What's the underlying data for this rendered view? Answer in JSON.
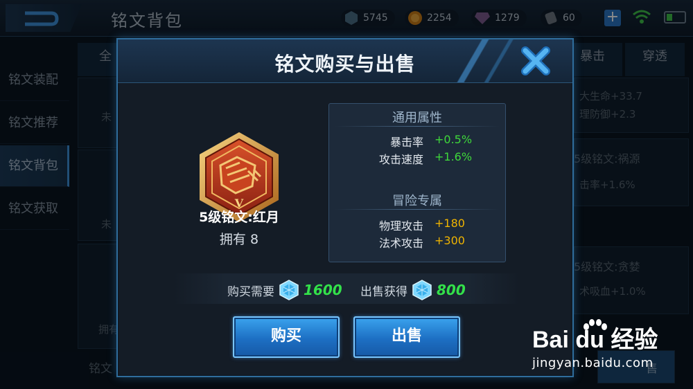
{
  "background": {
    "title": "铭文背包",
    "resources": [
      {
        "icon": "crystal-icon",
        "value": "5745"
      },
      {
        "icon": "gold-coin-icon",
        "value": "2254"
      },
      {
        "icon": "diamond-icon",
        "value": "1279"
      },
      {
        "icon": "scroll-icon",
        "value": "60"
      }
    ],
    "sidebar": [
      "铭文装配",
      "铭文推荐",
      "铭文背包",
      "铭文获取"
    ],
    "sidebar_active_index": 2,
    "tabs": [
      "全",
      "暴击",
      "穿透"
    ],
    "partial_texts": {
      "left_1": "未",
      "left_2": "未",
      "left_3": "拥有",
      "left_bottom": "铭文",
      "right_1": "大生命+33.7",
      "right_2": "理防御+2.3",
      "right_3": "5级铭文:祸源",
      "right_4": "击率+1.6%",
      "right_5": "5级铭文:贪婪",
      "right_6": "术吸血+1.0%",
      "right_btn": "售"
    }
  },
  "dialog": {
    "title": "铭文购买与出售",
    "item": {
      "name": "5级铭文:红月",
      "owned": "拥有 8",
      "level_mark": "V"
    },
    "general": {
      "title": "通用属性",
      "rows": [
        {
          "label": "暴击率",
          "value": "+0.5%"
        },
        {
          "label": "攻击速度",
          "value": "+1.6%"
        }
      ]
    },
    "adventure": {
      "title": "冒险专属",
      "rows": [
        {
          "label": "物理攻击",
          "value": "+180"
        },
        {
          "label": "法术攻击",
          "value": "+300"
        }
      ]
    },
    "buy_price_label": "购买需要",
    "buy_price": "1600",
    "sell_price_label": "出售获得",
    "sell_price": "800",
    "buy_button": "购买",
    "sell_button": "出售"
  },
  "watermark": {
    "logo": "Bai du 经验",
    "url": "jingyan.baidu.com"
  },
  "colors": {
    "accent_blue": "#2a86d8",
    "green_value": "#3fd83a",
    "orange_value": "#f0b400"
  }
}
